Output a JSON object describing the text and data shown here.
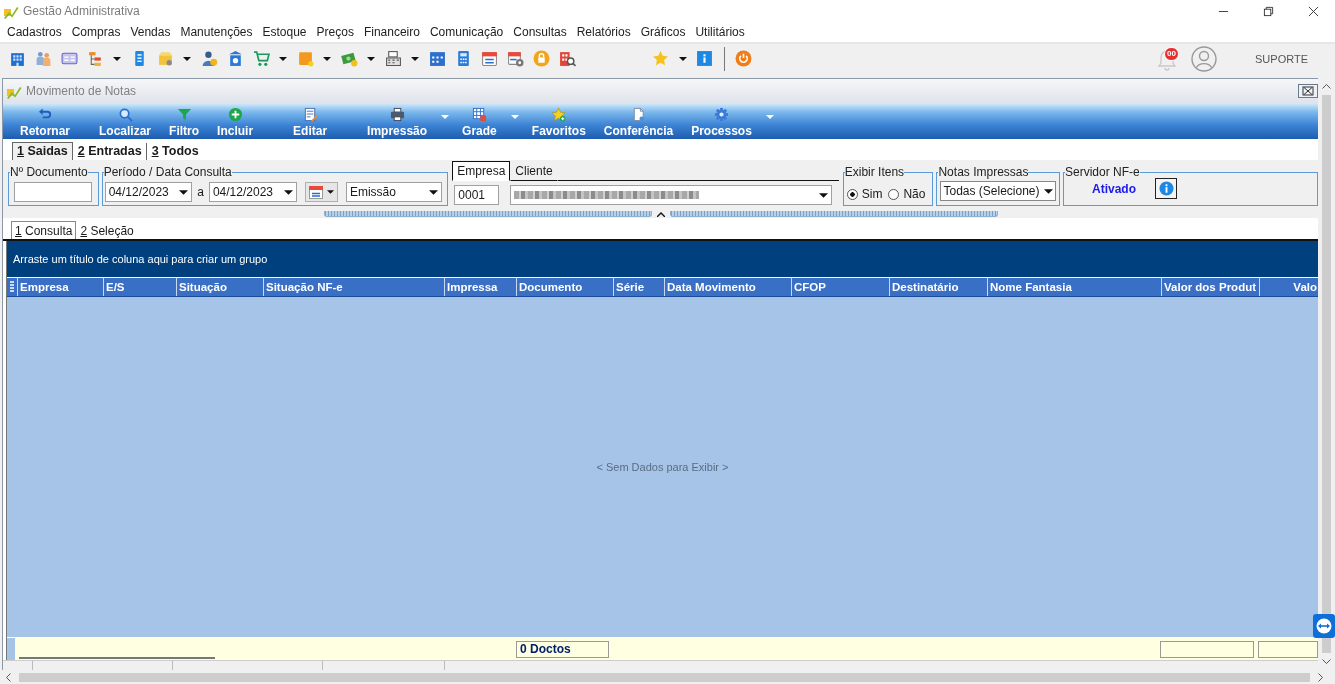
{
  "window": {
    "title": "Gestão Administrativa"
  },
  "menu": [
    "Cadastros",
    "Compras",
    "Vendas",
    "Manutenções",
    "Estoque",
    "Preços",
    "Financeiro",
    "Comunicação",
    "Consultas",
    "Relatórios",
    "Gráficos",
    "Utilitários"
  ],
  "toolbar": {
    "notification_count": "00",
    "user": "SUPORTE"
  },
  "document": {
    "title": "Movimento de Notas",
    "actions": [
      {
        "label": "Retornar",
        "dropdown": false
      },
      {
        "label": "Localizar",
        "dropdown": false
      },
      {
        "label": "Filtro",
        "dropdown": false
      },
      {
        "label": "Incluir",
        "dropdown": false
      },
      {
        "label": "Editar",
        "dropdown": false
      },
      {
        "label": "Impressão",
        "dropdown": true
      },
      {
        "label": "Grade",
        "dropdown": true
      },
      {
        "label": "Favoritos",
        "dropdown": false
      },
      {
        "label": "Conferência",
        "dropdown": false
      },
      {
        "label": "Processos",
        "dropdown": true
      }
    ],
    "tabs": [
      {
        "label": "1 Saidas",
        "selected": true
      },
      {
        "label": "2 Entradas",
        "selected": false
      },
      {
        "label": "3 Todos",
        "selected": false
      }
    ],
    "filters": {
      "document_number": {
        "label": "Nº Documento"
      },
      "period": {
        "label": "Período / Data Consulta",
        "from": "04/12/2023",
        "separator": "a",
        "to": "04/12/2023",
        "date_type": "Emissão"
      },
      "party": {
        "tabs": [
          {
            "label": "Empresa",
            "selected": true
          },
          {
            "label": "Cliente",
            "selected": false
          }
        ],
        "company": "0001"
      },
      "show_items": {
        "label": "Exibir Itens",
        "options": [
          {
            "label": "Sim",
            "selected": true
          },
          {
            "label": "Não",
            "selected": false
          }
        ]
      },
      "printed_notes": {
        "label": "Notas Impressas",
        "value": "Todas (Selecione)"
      },
      "nfe_server": {
        "label": "Servidor NF-e",
        "status": "Ativado"
      }
    },
    "subtabs": [
      {
        "label": "1 Consulta",
        "selected": true
      },
      {
        "label": "2 Seleção",
        "selected": false
      }
    ],
    "grid": {
      "group_hint": "Arraste um título de coluna aqui para criar um grupo",
      "columns": [
        "Empresa",
        "E/S",
        "Situação",
        "Situação NF-e",
        "Impressa",
        "Documento",
        "Série",
        "Data Movimento",
        "CFOP",
        "Destinatário",
        "Nome Fantasia",
        "Valor dos Produt",
        "Valo"
      ],
      "empty_message": "< Sem Dados para Exibir >"
    },
    "footer": {
      "count": "0 Doctos"
    }
  }
}
